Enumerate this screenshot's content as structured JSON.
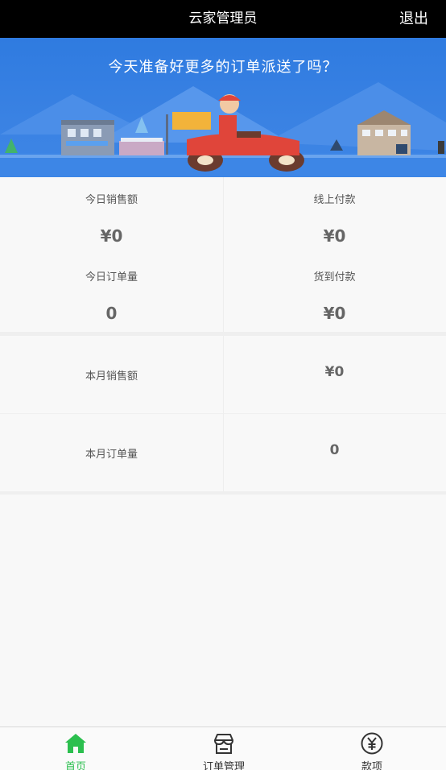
{
  "header": {
    "title": "云家管理员",
    "logout_label": "退出"
  },
  "banner": {
    "text": "今天准备好更多的订单派送了吗？"
  },
  "stats": {
    "today_sales_label": "今日销售额",
    "today_sales_value": "¥0",
    "online_payment_label": "线上付款",
    "online_payment_value": "¥0",
    "today_orders_label": "今日订单量",
    "today_orders_value": "0",
    "cod_payment_label": "货到付款",
    "cod_payment_value": "¥0",
    "month_sales_label": "本月销售额",
    "month_sales_value": "¥0",
    "month_orders_label": "本月订单量",
    "month_orders_value": "0"
  },
  "nav": {
    "items": [
      {
        "label": "首页",
        "icon": "home-icon",
        "active": true
      },
      {
        "label": "订单管理",
        "icon": "store-icon",
        "active": false
      },
      {
        "label": "款项",
        "icon": "yuan-icon",
        "active": false
      }
    ]
  },
  "colors": {
    "active": "#2bbf4e",
    "banner": "#3a82e3",
    "topbar": "#000000"
  }
}
